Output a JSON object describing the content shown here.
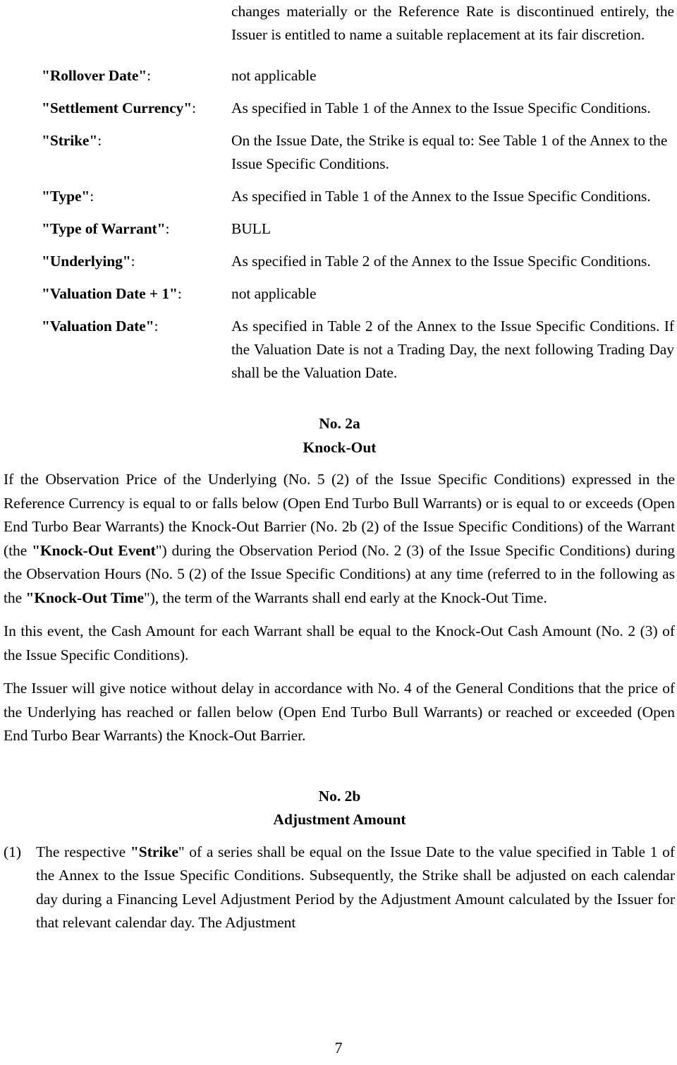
{
  "document": {
    "page_number": "7",
    "intro_continuation": "changes materially or the Reference Rate is discontinued entirely, the Issuer is entitled to name a suitable replacement at its fair discretion.",
    "definitions": [
      {
        "label": "\"Rollover Date\"",
        "colon": ":",
        "value": "not applicable"
      },
      {
        "label": "\"Settlement Currency\"",
        "colon": ":",
        "value": "As specified in Table 1 of the Annex to the Issue Specific Conditions."
      },
      {
        "label": "\"Strike\"",
        "colon": ":",
        "value": "On the Issue Date, the Strike is equal to: See Table 1 of the Annex to the Issue Specific Conditions."
      },
      {
        "label": "\"Type\"",
        "colon": ":",
        "value": "As specified in Table 1 of the Annex to the Issue Specific Conditions."
      },
      {
        "label": "\"Type of Warrant\"",
        "colon": ":",
        "value": "BULL"
      },
      {
        "label": "\"Underlying\"",
        "colon": ":",
        "value": "As specified in Table 2 of the Annex to the Issue Specific Conditions."
      },
      {
        "label": "\"Valuation Date + 1\"",
        "colon": ":",
        "value": "not applicable"
      },
      {
        "label": "\"Valuation Date\"",
        "colon": ":",
        "value": "As specified in Table 2 of the Annex to the Issue Specific Conditions. If the Valuation Date is not a Trading Day, the next following Trading Day shall be the Valuation Date."
      }
    ],
    "section_2a": {
      "number": "No. 2a",
      "title": "Knock-Out",
      "paragraph_1_part_1": "If the Observation Price of the Underlying (No. 5 (2) of the Issue Specific Conditions) expressed in the Reference Currency is equal to or falls below (Open End Turbo Bull Warrants) or is equal to or exceeds (Open End Turbo Bear Warrants) the Knock-Out Barrier (No. 2b (2) of the Issue Specific Conditions) of the Warrant (the ",
      "paragraph_1_bold_1": "\"Knock-Out Event",
      "paragraph_1_part_2": "\") during the Observation Period (No. 2 (3) of the Issue Specific Conditions) during the Observation Hours (No. 5 (2) of the Issue Specific Conditions) at any time (referred to in the following as the ",
      "paragraph_1_bold_2": "\"Knock-Out Time",
      "paragraph_1_part_3": "\"), the term of the Warrants shall end early at the Knock-Out Time.",
      "paragraph_2": "In this event, the Cash Amount for each Warrant shall be equal to the Knock-Out Cash Amount (No. 2 (3) of the Issue Specific Conditions).",
      "paragraph_3": "The Issuer will give notice without delay in accordance with No. 4 of the General Conditions that the price of the Underlying has reached or fallen below (Open End Turbo Bull Warrants) or reached or exceeded (Open End Turbo Bear Warrants) the Knock-Out Barrier."
    },
    "section_2b": {
      "number": "No. 2b",
      "title": "Adjustment Amount",
      "item_1_number": "(1)",
      "item_1_part_1": "The respective ",
      "item_1_bold_1": "\"Strike",
      "item_1_part_2": "\" of a series shall be equal on the Issue Date to the value specified in Table 1 of the Annex to the Issue Specific Conditions. Subsequently, the Strike shall be adjusted on each calendar day during a Financing Level Adjustment Period by the Adjustment Amount calculated by the Issuer for that relevant calendar day. The Adjustment"
    }
  }
}
